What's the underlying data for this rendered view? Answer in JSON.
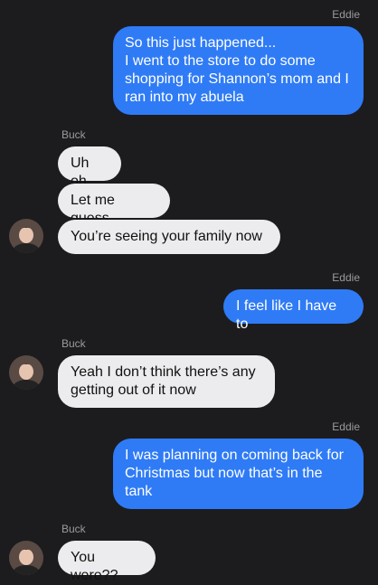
{
  "messages": [
    {
      "sender": "Eddie",
      "text": "So this just happened...\nI went to the store to do some shopping for Shannon’s mom and I ran into my abuela"
    },
    {
      "sender": "Buck",
      "text": "Uh oh"
    },
    {
      "text": "Let me guess"
    },
    {
      "text": "You’re seeing your family now"
    },
    {
      "sender": "Eddie",
      "text": "I feel like I have to"
    },
    {
      "sender": "Buck",
      "text": "Yeah I don’t think there’s any getting out of it now"
    },
    {
      "sender": "Eddie",
      "text": "I was planning on coming back for Christmas but now that’s in the tank"
    },
    {
      "sender": "Buck",
      "text": "You were??"
    }
  ]
}
